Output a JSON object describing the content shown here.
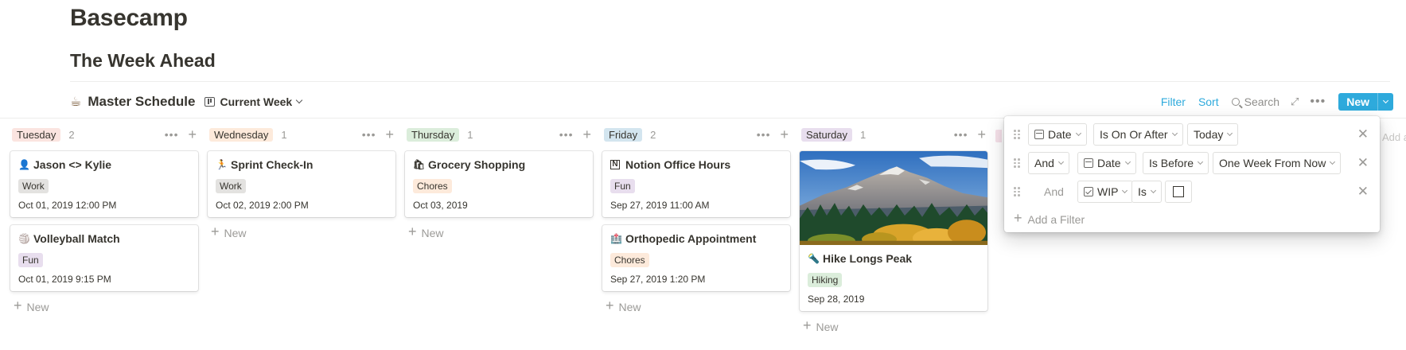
{
  "workspace_title": "Basecamp",
  "page_title": "The Week Ahead",
  "toolbar": {
    "db_icon": "coffee-icon",
    "db_name": "Master Schedule",
    "view_name": "Current Week",
    "filter_label": "Filter",
    "sort_label": "Sort",
    "search_label": "Search",
    "new_label": "New"
  },
  "colors": {
    "accent": "#2eaadc",
    "tag_tuesday": "#fbe4e0",
    "tag_wednesday": "#fdeadb",
    "tag_thursday": "#dbeddb",
    "tag_friday": "#d3e5ef",
    "tag_saturday": "#e8deee",
    "tag_work": "#e3e2e0",
    "tag_fun": "#e8deee",
    "tag_chores": "#fdeadb",
    "tag_hiking": "#dbeddb"
  },
  "columns": [
    {
      "name": "Tuesday",
      "count": "2",
      "new_label": "New",
      "cards": [
        {
          "icon": "person-icon",
          "glyph": "👤",
          "title": "Jason <> Kylie",
          "tag": "Work",
          "date": "Oct 01, 2019 12:00 PM"
        },
        {
          "icon": "volleyball-icon",
          "glyph": "🏐",
          "title": "Volleyball Match",
          "tag": "Fun",
          "date": "Oct 01, 2019 9:15 PM"
        }
      ]
    },
    {
      "name": "Wednesday",
      "count": "1",
      "new_label": "New",
      "cards": [
        {
          "icon": "runner-icon",
          "glyph": "🏃",
          "title": "Sprint Check-In",
          "tag": "Work",
          "date": "Oct 02, 2019 2:00 PM"
        }
      ]
    },
    {
      "name": "Thursday",
      "count": "1",
      "new_label": "New",
      "cards": [
        {
          "icon": "shopping-bags-icon",
          "glyph": "🛍",
          "title": "Grocery Shopping",
          "tag": "Chores",
          "date": "Oct 03, 2019"
        }
      ]
    },
    {
      "name": "Friday",
      "count": "2",
      "new_label": "New",
      "cards": [
        {
          "icon": "notion-logo-icon",
          "glyph": "N",
          "title": "Notion Office Hours",
          "tag": "Fun",
          "date": "Sep 27, 2019 11:00 AM"
        },
        {
          "icon": "hospital-icon",
          "glyph": "🏥",
          "title": "Orthopedic Appointment",
          "tag": "Chores",
          "date": "Sep 27, 2019 1:20 PM"
        }
      ]
    },
    {
      "name": "Saturday",
      "count": "1",
      "new_label": "New",
      "cards": [
        {
          "icon": "flashlight-icon",
          "glyph": "🔦",
          "title": "Hike Longs Peak",
          "tag": "Hiking",
          "date": "Sep 28, 2019",
          "cover": "mountain-landscape"
        }
      ]
    }
  ],
  "hidden_column_hint": "Add a",
  "filters": {
    "rows": [
      {
        "conjunction": "",
        "property": "Date",
        "operator": "Is On Or After",
        "value": "Today"
      },
      {
        "conjunction": "And",
        "property": "Date",
        "operator": "Is Before",
        "value": "One Week From Now"
      },
      {
        "conjunction": "And",
        "property": "WIP",
        "operator": "Is",
        "value": "unchecked"
      }
    ],
    "add_label": "Add a Filter"
  }
}
